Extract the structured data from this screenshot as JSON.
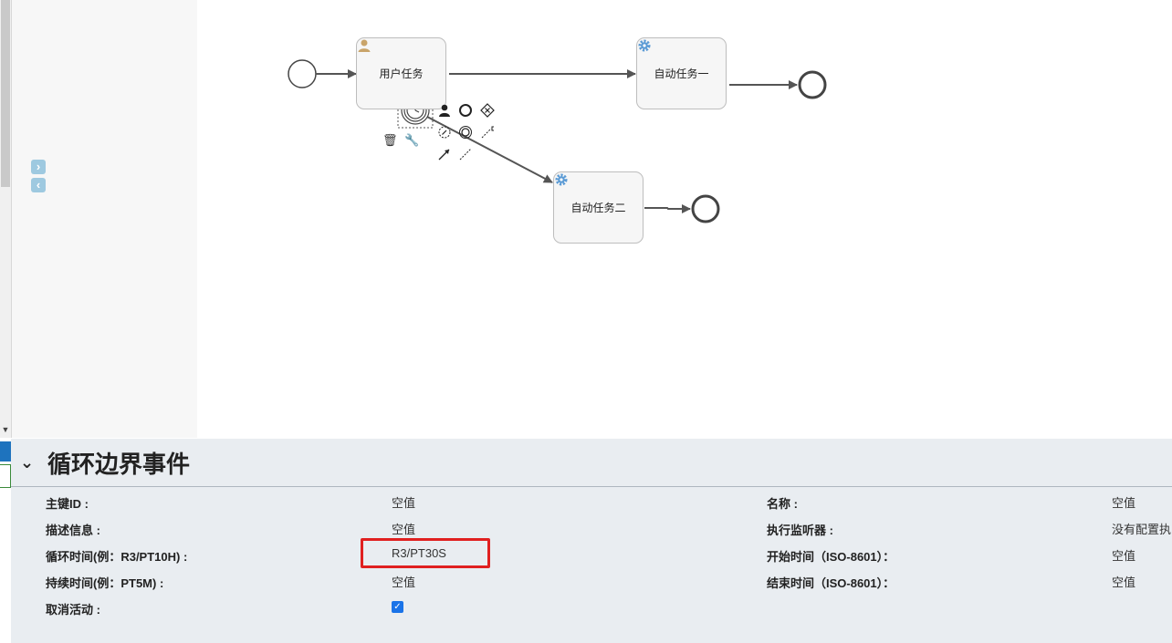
{
  "diagram": {
    "tasks": [
      {
        "label": "用户任务",
        "icon": "user-icon"
      },
      {
        "label": "自动任务一",
        "icon": "gear-icon"
      },
      {
        "label": "自动任务二",
        "icon": "gear-icon"
      }
    ],
    "context_pad": [
      "delete-icon",
      "wrench-icon",
      "user-task-icon",
      "end-event-icon",
      "gateway-icon",
      "intermediate-event-icon",
      "boundary-event-icon",
      "text-annotation-icon",
      "connect-icon",
      "association-icon"
    ]
  },
  "palette": {
    "expand_icon": "chevron-right-icon",
    "collapse_icon": "chevron-left-icon"
  },
  "properties": {
    "title": "循环边界事件",
    "rows_left": [
      {
        "label": "主键ID :",
        "value": "空值"
      },
      {
        "label": "描述信息 :",
        "value": "空值"
      },
      {
        "label": "循环时间(例：R3/PT10H) :",
        "value": "R3/PT30S"
      },
      {
        "label": "持续时间(例：PT5M) :",
        "value": "空值"
      },
      {
        "label": "取消活动 :",
        "value_checked": true
      }
    ],
    "rows_right": [
      {
        "label": "名称 :",
        "value": "空值"
      },
      {
        "label": "执行监听器 :",
        "value": "没有配置执"
      },
      {
        "label": "开始时间（ISO-8601）：",
        "value": "空值"
      },
      {
        "label": "结束时间（ISO-8601）：",
        "value": "空值"
      }
    ]
  },
  "colors": {
    "accent": "#1a73e8",
    "highlight": "#e02020",
    "panel_bg": "#e9edf1",
    "gear": "#5b9bd5",
    "user": "#c9a46a"
  }
}
